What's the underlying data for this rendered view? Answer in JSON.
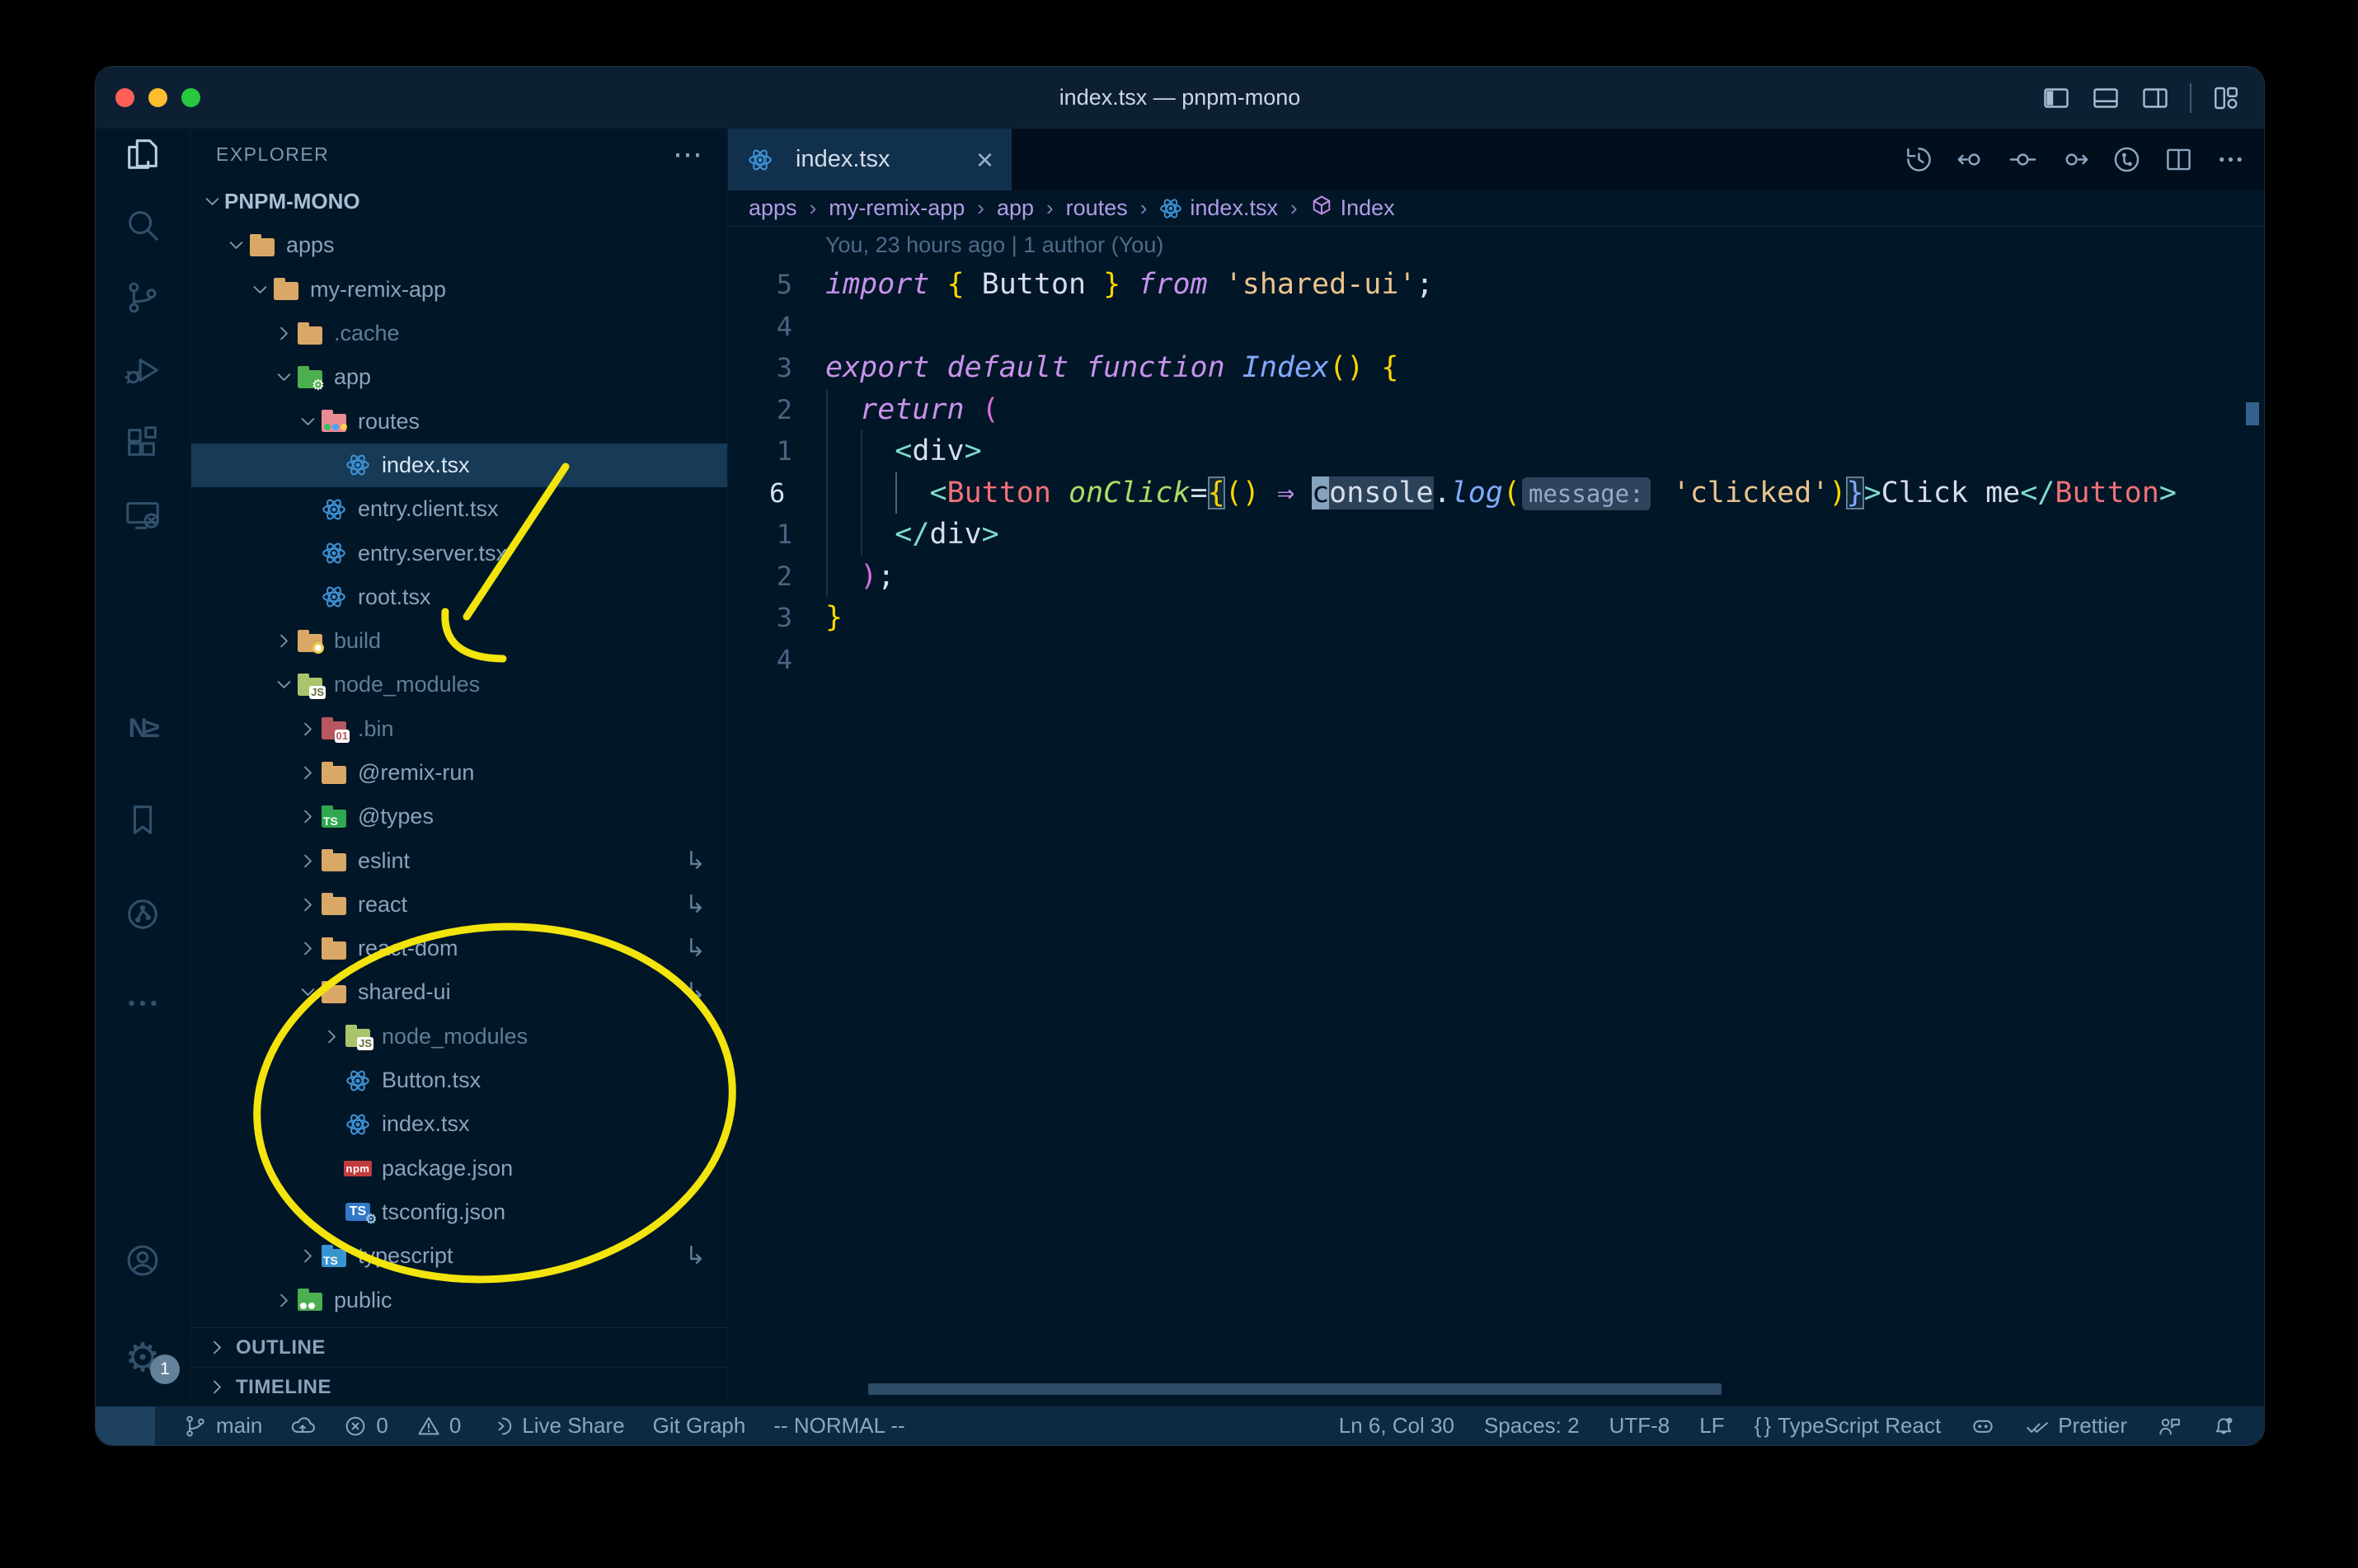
{
  "window": {
    "title": "index.tsx — pnpm-mono"
  },
  "titlebar": {
    "traffic_lights": [
      {
        "name": "close",
        "color": "#ff5f57"
      },
      {
        "name": "minimize",
        "color": "#febc2e"
      },
      {
        "name": "zoom",
        "color": "#28c840"
      }
    ],
    "right_icons": [
      "toggle-primary-sidebar",
      "toggle-panel",
      "toggle-secondary-sidebar",
      "divider",
      "customize-layout"
    ]
  },
  "activity_bar": {
    "items": [
      {
        "name": "explorer",
        "active": true
      },
      {
        "name": "search"
      },
      {
        "name": "source-control"
      },
      {
        "name": "run-debug"
      },
      {
        "name": "extensions"
      },
      {
        "name": "remote-explorer"
      },
      {
        "name": "nx-console"
      },
      {
        "name": "bookmarks"
      },
      {
        "name": "git-graph"
      },
      {
        "name": "more"
      }
    ],
    "bottom_items": [
      {
        "name": "account"
      },
      {
        "name": "settings",
        "badge": "1"
      }
    ]
  },
  "sidebar": {
    "header": "EXPLORER",
    "tree": [
      {
        "label": "PNPM-MONO",
        "level": 0,
        "chevron": "expanded",
        "root": true
      },
      {
        "label": "apps",
        "level": 1,
        "chevron": "expanded",
        "icon": {
          "kind": "folder",
          "color": "#d9a866",
          "open": true
        }
      },
      {
        "label": "my-remix-app",
        "level": 2,
        "chevron": "expanded",
        "icon": {
          "kind": "folder",
          "color": "#d9a866",
          "open": true
        }
      },
      {
        "label": ".cache",
        "level": 3,
        "chevron": "collapsed",
        "dim": true,
        "icon": {
          "kind": "folder",
          "color": "#d9a866"
        }
      },
      {
        "label": "app",
        "level": 3,
        "chevron": "expanded",
        "icon": {
          "kind": "folder",
          "color": "#4caf50",
          "open": true,
          "badge": "gear"
        }
      },
      {
        "label": "routes",
        "level": 4,
        "chevron": "expanded",
        "icon": {
          "kind": "folder",
          "color": "#e98b92",
          "open": true,
          "badge": "dots"
        }
      },
      {
        "label": "index.tsx",
        "level": 5,
        "selected": true,
        "icon": {
          "kind": "react"
        }
      },
      {
        "label": "entry.client.tsx",
        "level": 4,
        "icon": {
          "kind": "react"
        }
      },
      {
        "label": "entry.server.tsx",
        "level": 4,
        "icon": {
          "kind": "react"
        }
      },
      {
        "label": "root.tsx",
        "level": 4,
        "icon": {
          "kind": "react"
        }
      },
      {
        "label": "build",
        "level": 3,
        "chevron": "collapsed",
        "dim": true,
        "icon": {
          "kind": "folder",
          "color": "#d9a866",
          "badge": "circle"
        }
      },
      {
        "label": "node_modules",
        "level": 3,
        "chevron": "expanded",
        "dim": true,
        "icon": {
          "kind": "folder",
          "color": "#a9c46c",
          "open": true,
          "badge": "js"
        }
      },
      {
        "label": ".bin",
        "level": 4,
        "chevron": "collapsed",
        "dim": true,
        "icon": {
          "kind": "folder",
          "color": "#b8575f",
          "badge": "bin"
        }
      },
      {
        "label": "@remix-run",
        "level": 4,
        "chevron": "collapsed",
        "icon": {
          "kind": "folder",
          "color": "#d9a866"
        }
      },
      {
        "label": "@types",
        "level": 4,
        "chevron": "collapsed",
        "icon": {
          "kind": "folder",
          "color": "#2fa84f",
          "badge": "ts"
        }
      },
      {
        "label": "eslint",
        "level": 4,
        "chevron": "collapsed",
        "symlink": true,
        "icon": {
          "kind": "folder",
          "color": "#d9a866"
        }
      },
      {
        "label": "react",
        "level": 4,
        "chevron": "collapsed",
        "symlink": true,
        "icon": {
          "kind": "folder",
          "color": "#d9a866"
        }
      },
      {
        "label": "react-dom",
        "level": 4,
        "chevron": "collapsed",
        "symlink": true,
        "icon": {
          "kind": "folder",
          "color": "#d9a866"
        }
      },
      {
        "label": "shared-ui",
        "level": 4,
        "chevron": "expanded",
        "symlink": true,
        "icon": {
          "kind": "folder",
          "color": "#d9a866",
          "open": true
        }
      },
      {
        "label": "node_modules",
        "level": 5,
        "chevron": "collapsed",
        "dim": true,
        "icon": {
          "kind": "folder",
          "color": "#a9c46c",
          "badge": "js"
        }
      },
      {
        "label": "Button.tsx",
        "level": 5,
        "icon": {
          "kind": "react"
        }
      },
      {
        "label": "index.tsx",
        "level": 5,
        "icon": {
          "kind": "react"
        }
      },
      {
        "label": "package.json",
        "level": 5,
        "icon": {
          "kind": "npm"
        }
      },
      {
        "label": "tsconfig.json",
        "level": 5,
        "icon": {
          "kind": "tsconfig"
        }
      },
      {
        "label": "typescript",
        "level": 4,
        "chevron": "collapsed",
        "symlink": true,
        "icon": {
          "kind": "folder",
          "color": "#3794d1",
          "badge": "ts"
        }
      },
      {
        "label": "public",
        "level": 3,
        "chevron": "collapsed",
        "icon": {
          "kind": "folder",
          "color": "#4caf50",
          "badge": "people"
        }
      }
    ],
    "sections": [
      "OUTLINE",
      "TIMELINE"
    ]
  },
  "tabbar": {
    "tabs": [
      {
        "label": "index.tsx",
        "icon": "react",
        "close": "×",
        "active": true
      }
    ],
    "actions": [
      "timeline-history",
      "prev-change",
      "current-change",
      "next-change",
      "git-circle",
      "split-editor",
      "more"
    ]
  },
  "breadcrumbs": {
    "separator": "›",
    "items": [
      {
        "label": "apps"
      },
      {
        "label": "my-remix-app"
      },
      {
        "label": "app"
      },
      {
        "label": "routes"
      },
      {
        "label": "index.tsx",
        "icon": "react"
      },
      {
        "label": "Index",
        "icon": "symbol-module"
      }
    ]
  },
  "editor": {
    "blame": "You, 23 hours ago | 1 author (You)",
    "lines": [
      {
        "num": "5",
        "guides": [],
        "tokens": [
          [
            "import",
            "kw"
          ],
          [
            " ",
            ""
          ],
          [
            "{",
            "gold"
          ],
          [
            " Button ",
            "fg"
          ],
          [
            "}",
            "gold"
          ],
          [
            " ",
            ""
          ],
          [
            "from",
            "kw"
          ],
          [
            " ",
            ""
          ],
          [
            "'shared-ui'",
            "str"
          ],
          [
            ";",
            "fg"
          ]
        ]
      },
      {
        "num": "4",
        "guides": [],
        "tokens": []
      },
      {
        "num": "3",
        "guides": [],
        "tokens": [
          [
            "export",
            "kw"
          ],
          [
            " ",
            ""
          ],
          [
            "default",
            "kw"
          ],
          [
            " ",
            ""
          ],
          [
            "function",
            "kw"
          ],
          [
            " ",
            ""
          ],
          [
            "Index",
            "fn"
          ],
          [
            "(",
            "gold"
          ],
          [
            ")",
            "gold"
          ],
          [
            " ",
            ""
          ],
          [
            "{",
            "gold"
          ]
        ]
      },
      {
        "num": "2",
        "guides": [
          0
        ],
        "tokens": [
          [
            "  ",
            ""
          ],
          [
            "return",
            "kw"
          ],
          [
            " ",
            ""
          ],
          [
            "(",
            "pink"
          ]
        ]
      },
      {
        "num": "1",
        "guides": [
          0,
          2
        ],
        "tokens": [
          [
            "    ",
            ""
          ],
          [
            "<",
            "cyan"
          ],
          [
            "div",
            "fg"
          ],
          [
            ">",
            "cyan"
          ]
        ]
      },
      {
        "num": "6",
        "current": true,
        "guides": [
          0,
          2
        ],
        "active_guide": 4,
        "tokens": [
          [
            "      ",
            ""
          ],
          [
            "<",
            "cyan"
          ],
          [
            "Button",
            "tag"
          ],
          [
            " ",
            ""
          ],
          [
            "onClick",
            "attr"
          ],
          [
            "=",
            "fg"
          ],
          [
            "{",
            "goldbox"
          ],
          [
            "(",
            "gold"
          ],
          [
            ")",
            "gold"
          ],
          [
            " ",
            ""
          ],
          [
            "⇒",
            "arrow"
          ],
          [
            " ",
            ""
          ],
          [
            "c",
            "cursor"
          ],
          [
            "onsole",
            "hl"
          ],
          [
            ".",
            "fg"
          ],
          [
            "log",
            "fn"
          ],
          [
            "(",
            "gold"
          ],
          [
            "message:",
            "inlay"
          ],
          [
            " ",
            ""
          ],
          [
            "'clicked'",
            "str"
          ],
          [
            ")",
            "gold"
          ],
          [
            "}",
            "bluebox"
          ],
          [
            ">",
            "cyan"
          ],
          [
            "Click me",
            "fg"
          ],
          [
            "</",
            "cyan"
          ],
          [
            "Button",
            "tag"
          ],
          [
            ">",
            "cyan"
          ]
        ]
      },
      {
        "num": "1",
        "guides": [
          0,
          2
        ],
        "tokens": [
          [
            "    ",
            ""
          ],
          [
            "</",
            "cyan"
          ],
          [
            "div",
            "fg"
          ],
          [
            ">",
            "cyan"
          ]
        ]
      },
      {
        "num": "2",
        "guides": [
          0
        ],
        "tokens": [
          [
            "  ",
            ""
          ],
          [
            ")",
            "pink"
          ],
          [
            ";",
            "fg"
          ]
        ]
      },
      {
        "num": "3",
        "guides": [],
        "tokens": [
          [
            "}",
            "gold"
          ]
        ]
      },
      {
        "num": "4",
        "guides": [],
        "tokens": []
      }
    ]
  },
  "statusbar": {
    "left": [
      {
        "icon": "remote",
        "chip": true,
        "name": "remote-indicator"
      },
      {
        "icon": "git-branch",
        "label": "main",
        "name": "branch"
      },
      {
        "icon": "cloud-upload",
        "name": "publish"
      },
      {
        "icon": "error",
        "label": "0",
        "name": "errors"
      },
      {
        "icon": "warning",
        "label": "0",
        "name": "warnings"
      },
      {
        "icon": "live-share",
        "label": "Live Share",
        "name": "live-share"
      },
      {
        "label": "Git Graph",
        "name": "git-graph"
      },
      {
        "label": "-- NORMAL --",
        "name": "vim-mode"
      }
    ],
    "right": [
      {
        "label": "Ln 6, Col 30",
        "name": "cursor-position"
      },
      {
        "label": "Spaces: 2",
        "name": "indentation"
      },
      {
        "label": "UTF-8",
        "name": "encoding"
      },
      {
        "label": "LF",
        "name": "eol"
      },
      {
        "icon": "braces",
        "label": "TypeScript React",
        "name": "language-mode"
      },
      {
        "icon": "copilot",
        "name": "copilot"
      },
      {
        "icon": "double-check",
        "label": "Prettier",
        "name": "formatter"
      },
      {
        "icon": "feedback",
        "name": "feedback"
      },
      {
        "icon": "bell-dot",
        "name": "notifications"
      }
    ]
  },
  "annotations": {
    "color": "#f2e40c",
    "marks": [
      "arrow-to-node-modules",
      "circle-around-shared-ui"
    ]
  },
  "colors": {
    "editor_bg": "#011627",
    "titlebar_bg": "#0d2033",
    "statusbar_bg": "#0e2a42",
    "selected_row": "#173a56",
    "keyword": "#c792ea",
    "string": "#ecc48d",
    "tag": "#f07178",
    "attribute": "#addb67",
    "punct_gold": "#ffd602",
    "bracket_pink": "#d670d6",
    "bracket_blue": "#82aaff",
    "jsx_bracket": "#7fdbca",
    "foreground": "#d6deeb",
    "breadcrumb": "#b09ce6"
  }
}
